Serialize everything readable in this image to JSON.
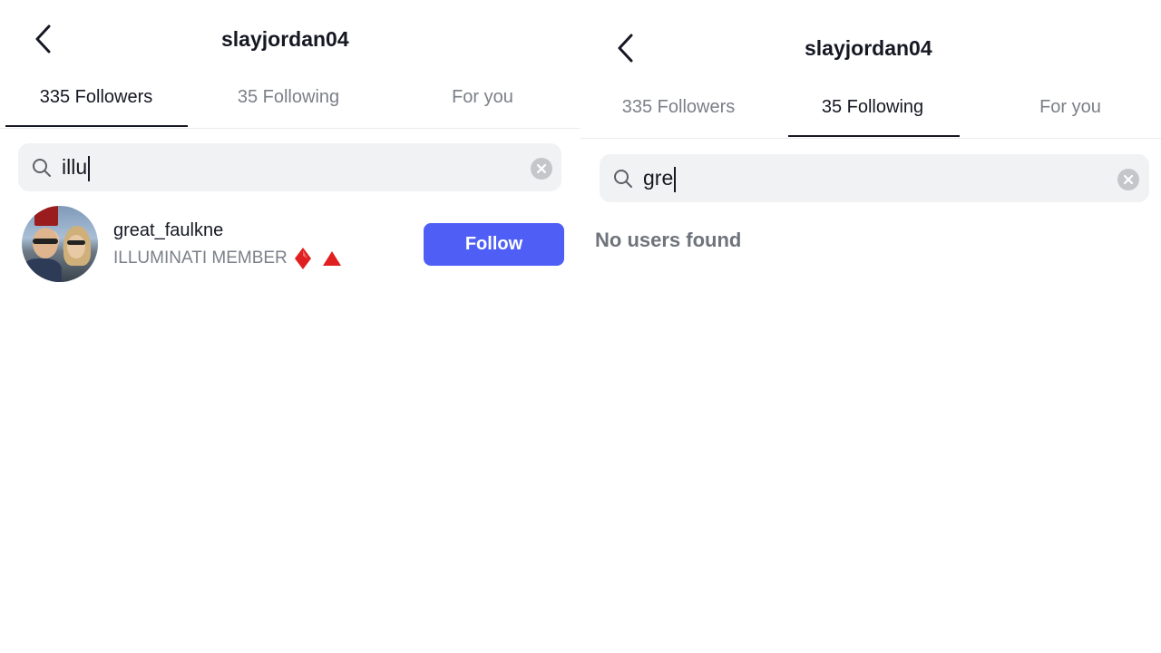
{
  "left": {
    "title": "slayjordan04",
    "tabs": [
      {
        "label": "335 Followers",
        "active": true
      },
      {
        "label": "35 Following",
        "active": false
      },
      {
        "label": "For you",
        "active": false
      }
    ],
    "search": {
      "query": "illu"
    },
    "results": [
      {
        "username": "great_faulkne",
        "bio": "ILLUMINATI MEMBER",
        "bio_emojis": [
          "red-diamond",
          "red-triangle"
        ],
        "button_label": "Follow"
      }
    ]
  },
  "right": {
    "title": "slayjordan04",
    "tabs": [
      {
        "label": "335 Followers",
        "active": false
      },
      {
        "label": "35 Following",
        "active": true
      },
      {
        "label": "For you",
        "active": false
      }
    ],
    "search": {
      "query": "gre"
    },
    "empty_message": "No users found"
  },
  "colors": {
    "accent": "#4f5ff5",
    "text_primary": "#161823",
    "text_secondary": "#7b7f87",
    "search_bg": "#f1f2f3",
    "emoji_red": "#e02020"
  },
  "icons": [
    "chevron-left-icon",
    "search-icon",
    "clear-icon"
  ]
}
